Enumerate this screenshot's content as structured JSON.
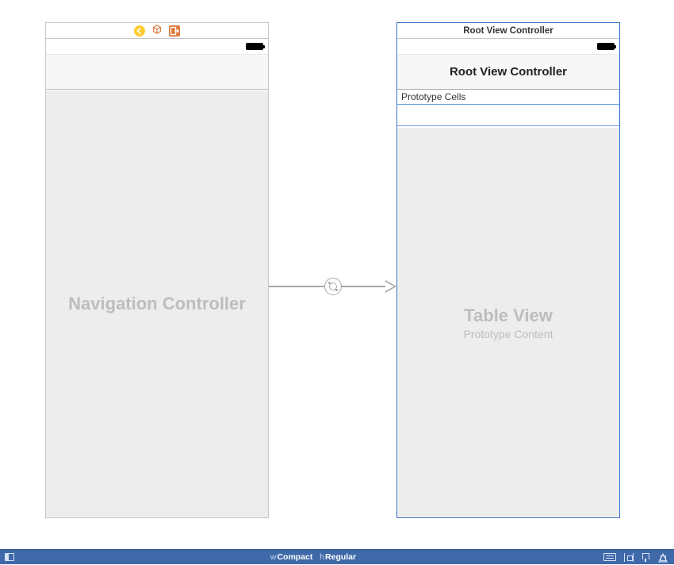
{
  "left_scene": {
    "title": "",
    "placeholder": "Navigation Controller"
  },
  "right_scene": {
    "header_title": "Root View Controller",
    "nav_title": "Root View Controller",
    "section_label": "Prototype Cells",
    "table_placeholder_title": "Table View",
    "table_placeholder_subtitle": "Prototype Content"
  },
  "bottom_bar": {
    "w_prefix": "w",
    "w_value": "Compact",
    "h_prefix": "h",
    "h_value": "Regular"
  }
}
